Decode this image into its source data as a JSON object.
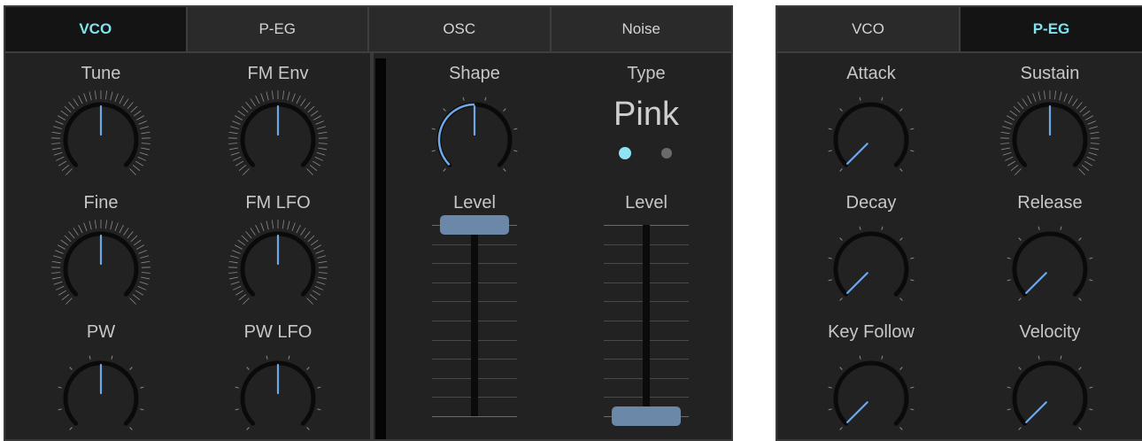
{
  "left_panel": {
    "tabs": [
      {
        "label": "VCO",
        "active": true
      },
      {
        "label": "P-EG",
        "active": false
      },
      {
        "label": "OSC",
        "active": false
      },
      {
        "label": "Noise",
        "active": false
      }
    ],
    "vco_knobs": [
      {
        "label": "Tune",
        "value": 0.5,
        "dense": true
      },
      {
        "label": "FM Env",
        "value": 0.5,
        "dense": true
      },
      {
        "label": "Fine",
        "value": 0.5,
        "dense": true
      },
      {
        "label": "FM LFO",
        "value": 0.5,
        "dense": true
      },
      {
        "label": "PW",
        "value": 0.5,
        "dense": false
      },
      {
        "label": "PW LFO",
        "value": 0.5,
        "dense": false
      }
    ],
    "osc": {
      "shape_label": "Shape",
      "shape_value": 0.5,
      "level_label": "Level",
      "level_value": 1.0
    },
    "noise": {
      "type_label": "Type",
      "type_value": "Pink",
      "options": [
        "selected",
        "unselected"
      ],
      "level_label": "Level",
      "level_value": 0.0
    }
  },
  "right_panel": {
    "tabs": [
      {
        "label": "VCO",
        "active": false
      },
      {
        "label": "P-EG",
        "active": true
      }
    ],
    "knobs": [
      {
        "label": "Attack",
        "value": 0.0,
        "dense": false
      },
      {
        "label": "Sustain",
        "value": 0.5,
        "dense": true
      },
      {
        "label": "Decay",
        "value": 0.0,
        "dense": false
      },
      {
        "label": "Release",
        "value": 0.0,
        "dense": false
      },
      {
        "label": "Key Follow",
        "value": 0.0,
        "dense": false
      },
      {
        "label": "Velocity",
        "value": 0.0,
        "dense": false
      }
    ]
  },
  "colors": {
    "accent": "#7fe3ee",
    "indicator": "#6fa8e8",
    "fader_thumb": "#6b88a8",
    "knob_arc": "#0a0a0a",
    "tick": "#8c8c8c"
  }
}
